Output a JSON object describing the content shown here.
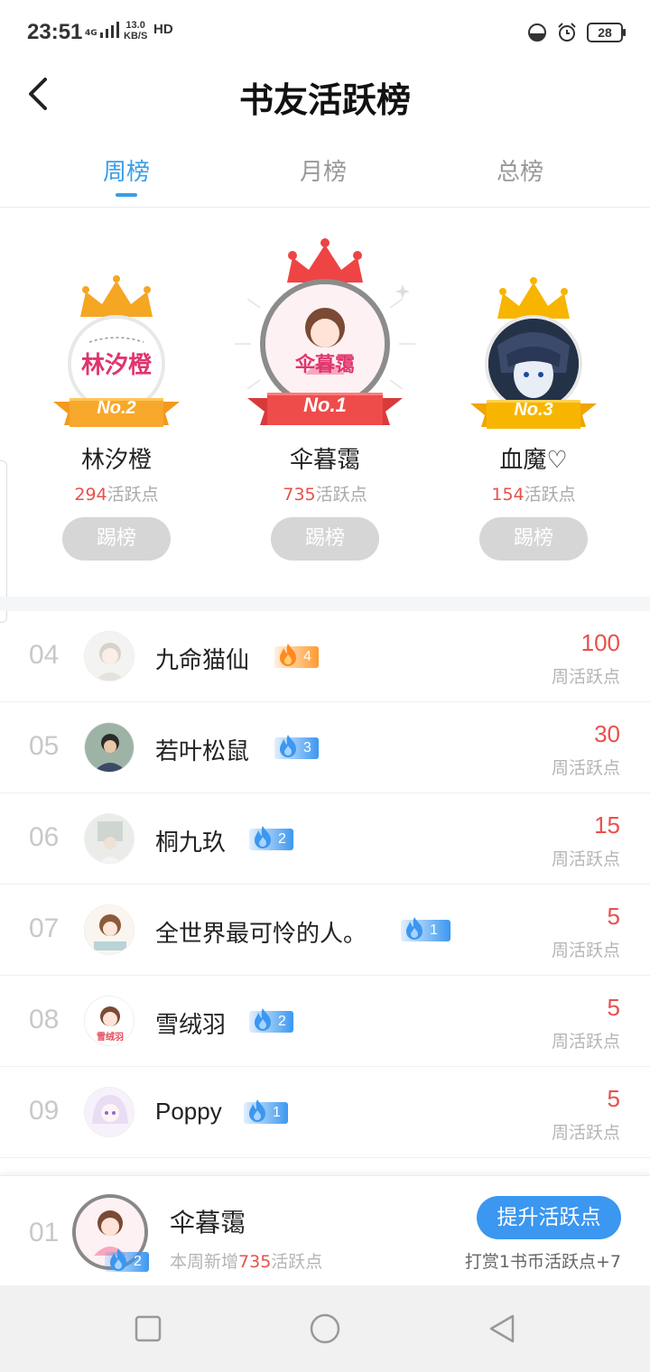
{
  "status": {
    "time": "23:51",
    "network": "4G",
    "speed_value": "13.0",
    "speed_unit": "KB/S",
    "hd": "HD",
    "battery": "28"
  },
  "header": {
    "title": "书友活跃榜"
  },
  "tabs": [
    {
      "label": "周榜",
      "active": true
    },
    {
      "label": "月榜",
      "active": false
    },
    {
      "label": "总榜",
      "active": false
    }
  ],
  "podium": {
    "second": {
      "rank_label": "No.2",
      "name": "林汐橙",
      "points": "294",
      "points_suffix": "活跃点",
      "button": "踢榜",
      "avatar_text": "林汐橙"
    },
    "first": {
      "rank_label": "No.1",
      "name": "伞暮霭",
      "points": "735",
      "points_suffix": "活跃点",
      "button": "踢榜",
      "avatar_text": "伞暮霭"
    },
    "third": {
      "rank_label": "No.3",
      "name": "血魔♡",
      "points": "154",
      "points_suffix": "活跃点",
      "button": "踢榜"
    }
  },
  "list": [
    {
      "rank": "04",
      "name": "九命猫仙",
      "level": "4",
      "badge": "orange",
      "score": "100",
      "score_label": "周活跃点"
    },
    {
      "rank": "05",
      "name": "若叶松鼠",
      "level": "3",
      "badge": "blue",
      "score": "30",
      "score_label": "周活跃点"
    },
    {
      "rank": "06",
      "name": "桐九玖",
      "level": "2",
      "badge": "blue",
      "score": "15",
      "score_label": "周活跃点"
    },
    {
      "rank": "07",
      "name": "全世界最可怜的人。",
      "level": "1",
      "badge": "blue",
      "score": "5",
      "score_label": "周活跃点"
    },
    {
      "rank": "08",
      "name": "雪绒羽",
      "level": "2",
      "badge": "blue",
      "score": "5",
      "score_label": "周活跃点"
    },
    {
      "rank": "09",
      "name": "Poppy",
      "level": "1",
      "badge": "blue",
      "score": "5",
      "score_label": "周活跃点"
    }
  ],
  "me": {
    "rank": "01",
    "name": "伞暮霭",
    "level": "2",
    "sub_prefix": "本周新增",
    "sub_points": "735",
    "sub_suffix": "活跃点",
    "button": "提升活跃点",
    "reward_text": "打赏1书币活跃点+7"
  },
  "colors": {
    "accent": "#3b97f0",
    "score_red": "#e9504b",
    "gold_crown": "#f5a623",
    "red_crown": "#ee4444"
  }
}
